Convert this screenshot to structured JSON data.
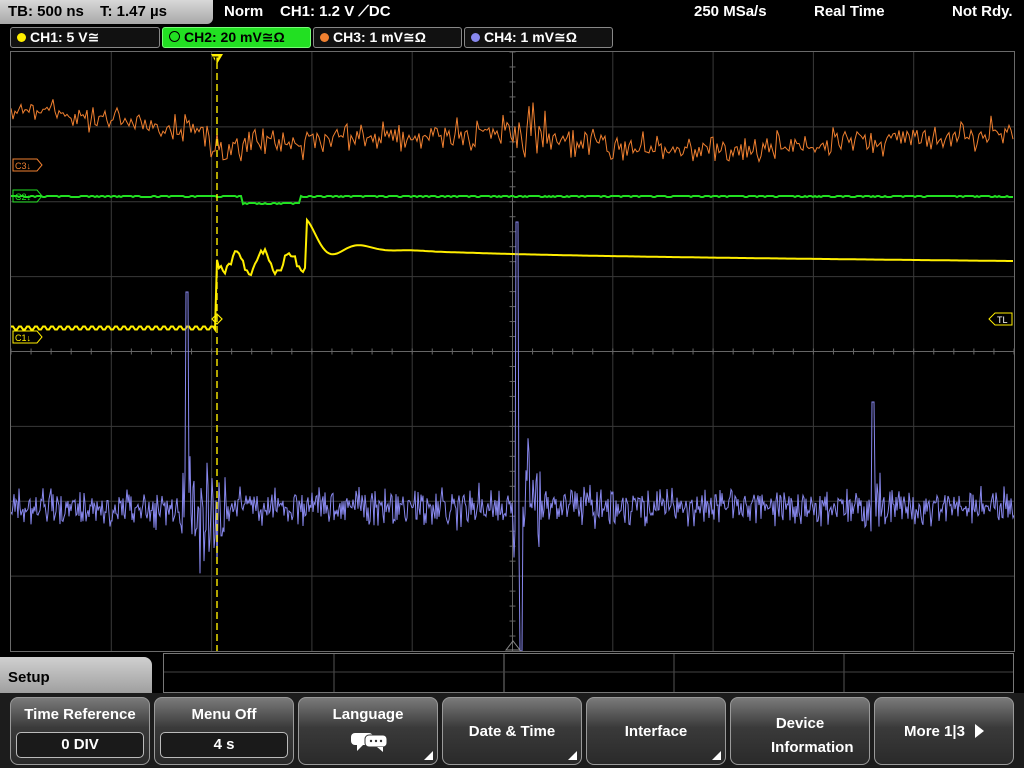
{
  "status": {
    "timebase": "TB: 500 ns",
    "trigger_time": "T: 1.47 µs",
    "mode": "Norm",
    "trigger": "CH1: 1.2 V ⟋DC",
    "sample_rate": "250 MSa/s",
    "acq_mode": "Real Time",
    "state": "Not Rdy."
  },
  "channels": [
    {
      "label": "CH1: 5 V≅",
      "color": "#ffee00",
      "active": false
    },
    {
      "label": "CH2: 20 mV≅Ω",
      "color": "#22e022",
      "active": true
    },
    {
      "label": "CH3: 1 mV≅Ω",
      "color": "#f08030",
      "active": false
    },
    {
      "label": "CH4: 1 mV≅Ω",
      "color": "#8888ee",
      "active": false
    }
  ],
  "markers": {
    "c3": "C3↓",
    "c2": "C2↓",
    "c1": "C1↓",
    "trigger_level": "TL",
    "trigger_pos": "T"
  },
  "menu": {
    "section_title": "Setup",
    "buttons": [
      {
        "label": "Time Reference",
        "value": "0 DIV"
      },
      {
        "label": "Menu Off",
        "value": "4 s"
      },
      {
        "label": "Language",
        "icon": "speech-bubbles-icon"
      },
      {
        "label": "Date & Time"
      },
      {
        "label": "Interface"
      },
      {
        "label": "Device Information"
      },
      {
        "label": "More 1|3",
        "icon": "arrow-right-icon"
      }
    ]
  }
}
